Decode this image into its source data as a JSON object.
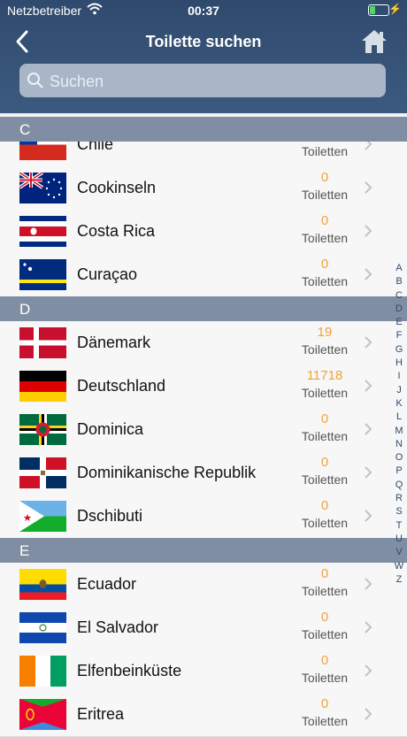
{
  "status_bar": {
    "carrier": "Netzbetreiber",
    "time": "00:37"
  },
  "nav": {
    "title": "Toilette suchen"
  },
  "search": {
    "placeholder": "Suchen"
  },
  "sections": [
    {
      "letter": "C",
      "rows": [
        {
          "name": "Chile",
          "count": "",
          "unit": "Toiletten",
          "flag": "chile"
        },
        {
          "name": "Cookinseln",
          "count": "0",
          "unit": "Toiletten",
          "flag": "cook"
        },
        {
          "name": "Costa Rica",
          "count": "0",
          "unit": "Toiletten",
          "flag": "costarica"
        },
        {
          "name": "Curaçao",
          "count": "0",
          "unit": "Toiletten",
          "flag": "curacao"
        }
      ]
    },
    {
      "letter": "D",
      "rows": [
        {
          "name": "Dänemark",
          "count": "19",
          "unit": "Toiletten",
          "flag": "denmark"
        },
        {
          "name": "Deutschland",
          "count": "11718",
          "unit": "Toiletten",
          "flag": "germany"
        },
        {
          "name": "Dominica",
          "count": "0",
          "unit": "Toiletten",
          "flag": "dominica"
        },
        {
          "name": "Dominikanische Republik",
          "count": "0",
          "unit": "Toiletten",
          "flag": "dominican"
        },
        {
          "name": "Dschibuti",
          "count": "0",
          "unit": "Toiletten",
          "flag": "djibouti"
        }
      ]
    },
    {
      "letter": "E",
      "rows": [
        {
          "name": "Ecuador",
          "count": "0",
          "unit": "Toiletten",
          "flag": "ecuador"
        },
        {
          "name": "El Salvador",
          "count": "0",
          "unit": "Toiletten",
          "flag": "elsalvador"
        },
        {
          "name": "Elfenbeinküste",
          "count": "0",
          "unit": "Toiletten",
          "flag": "ivorycoast"
        },
        {
          "name": "Eritrea",
          "count": "0",
          "unit": "Toiletten",
          "flag": "eritrea"
        }
      ]
    }
  ],
  "index_letters": [
    "A",
    "B",
    "C",
    "D",
    "E",
    "F",
    "G",
    "H",
    "I",
    "J",
    "K",
    "L",
    "M",
    "N",
    "O",
    "P",
    "Q",
    "R",
    "S",
    "T",
    "U",
    "V",
    "W",
    "Z"
  ],
  "colors": {
    "header": "#34506f",
    "accent_count": "#f0a23b",
    "section": "#7f8ea2"
  },
  "icons": {
    "back": "chevron-left-icon",
    "home": "home-icon",
    "search": "search-icon",
    "row": "chevron-right-icon"
  }
}
